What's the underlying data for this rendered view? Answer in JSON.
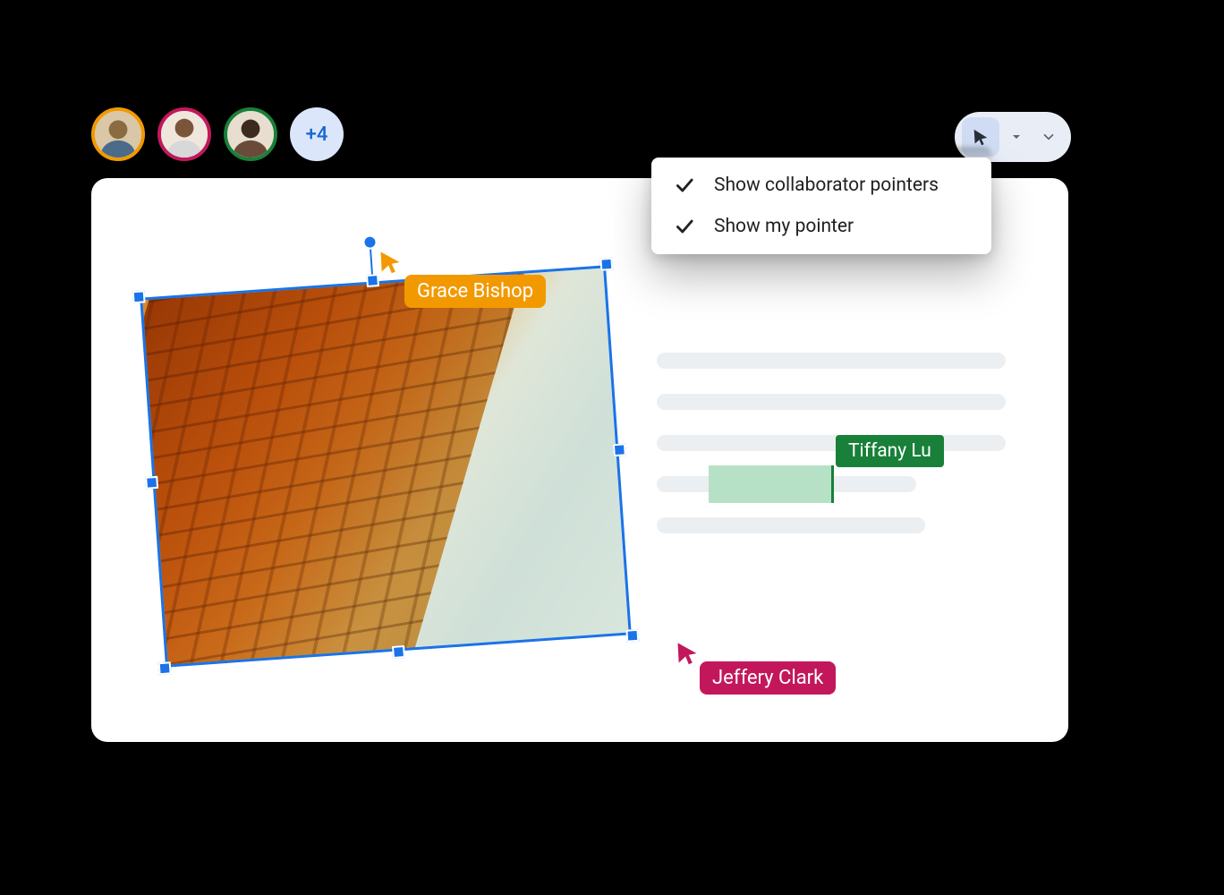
{
  "participants": {
    "avatars": [
      {
        "name": "Grace Bishop",
        "ring": "orange"
      },
      {
        "name": "Jeffery Clark",
        "ring": "magenta"
      },
      {
        "name": "Tiffany Lu",
        "ring": "green"
      }
    ],
    "overflow_label": "+4"
  },
  "pointer_menu": {
    "items": [
      {
        "label": "Show collaborator pointers",
        "checked": true
      },
      {
        "label": "Show my pointer",
        "checked": true
      }
    ]
  },
  "cursors": {
    "grace": {
      "label": "Grace Bishop",
      "color": "#f29900"
    },
    "jeffery": {
      "label": "Jeffery Clark",
      "color": "#c2185b"
    },
    "tiffany": {
      "label": "Tiffany Lu",
      "color": "#188038"
    }
  }
}
